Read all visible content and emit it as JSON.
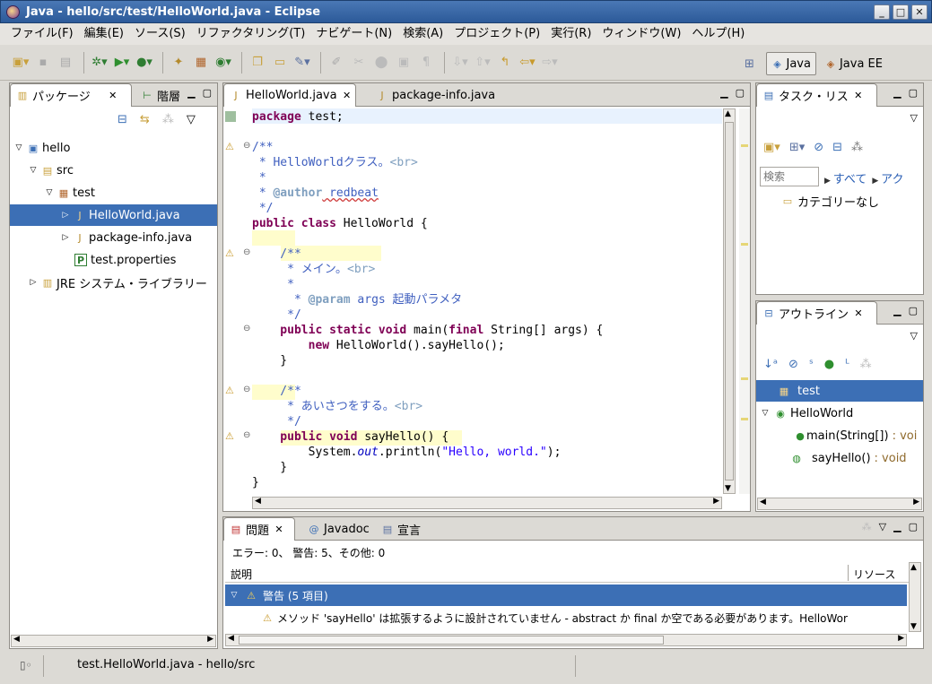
{
  "window": {
    "title": "Java - hello/src/test/HelloWorld.java - Eclipse"
  },
  "menubar": [
    "ファイル(F)",
    "編集(E)",
    "ソース(S)",
    "リファクタリング(T)",
    "ナビゲート(N)",
    "検索(A)",
    "プロジェクト(P)",
    "実行(R)",
    "ウィンドウ(W)",
    "ヘルプ(H)"
  ],
  "perspectives": {
    "java": "Java",
    "javaee": "Java EE"
  },
  "package_explorer": {
    "tab1": "パッケージ",
    "tab2": "階層",
    "tree": [
      "hello",
      "src",
      "test",
      "HelloWorld.java",
      "package-info.java",
      "test.properties",
      "JRE システム・ライブラリー"
    ]
  },
  "editor": {
    "tab1": "HelloWorld.java",
    "tab2": "package-info.java",
    "lines": {
      "l1": "package",
      "l1b": " test;",
      "l2": "/**",
      "l3": " * HelloWorldクラス。",
      "l3b": "<br>",
      "l4": " *",
      "l5a": " * ",
      "l5b": "@author",
      "l5c": " redbeat",
      "l6": " */",
      "l7a": "public class",
      "l7b": " HelloWorld {",
      "l8": "    /**",
      "l9": "     * メイン。",
      "l9b": "<br>",
      "l10": "     *",
      "l11a": "      * ",
      "l11b": "@param",
      "l11c": " args 起動パラメタ",
      "l12": "     */",
      "l13a": "    public static void",
      "l13b": " main(",
      "l13c": "final",
      "l13d": " String[] args) {",
      "l14a": "        new",
      "l14b": " HelloWorld().sayHello();",
      "l15": "    }",
      "l16": "    /**",
      "l17": "     * あいさつをする。",
      "l17b": "<br>",
      "l18": "     */",
      "l19a": "    public void",
      "l19b": " sayHello() {",
      "l20a": "        System.",
      "l20b": "out",
      "l20c": ".println(",
      "l20d": "\"Hello, world.\"",
      "l20e": ");",
      "l21": "    }",
      "l22": "}"
    }
  },
  "tasks": {
    "tab": "タスク・リス",
    "search_placeholder": "検索",
    "filter_all": "すべて",
    "filter_act": "アク",
    "category": "カテゴリーなし"
  },
  "outline": {
    "tab": "アウトライン",
    "items": [
      "test",
      "HelloWorld",
      "main(String[])",
      ": voi",
      "sayHello()",
      ": void"
    ]
  },
  "problems": {
    "tab1": "問題",
    "tab2": "Javadoc",
    "tab3": "宣言",
    "summary": "エラー: 0、 警告: 5、その他: 0",
    "col_desc": "説明",
    "col_res": "リソース",
    "group": "警告 (5 項目)",
    "row": "メソッド 'sayHello' は拡張するように設計されていません - abstract か final か空である必要があります。HelloWor"
  },
  "status": {
    "text": "test.HelloWorld.java - hello/src"
  }
}
